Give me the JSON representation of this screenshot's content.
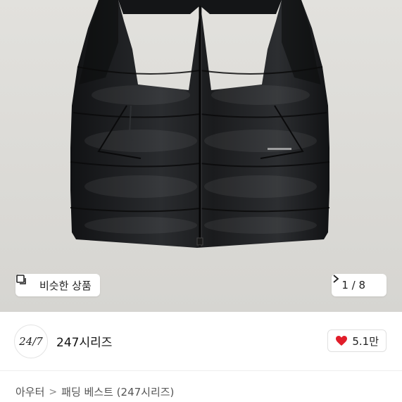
{
  "hero": {
    "image": "black-padded-vest-photo",
    "colors": {
      "background": "#dddcd8",
      "garment": "#1c1d1f"
    }
  },
  "similar": {
    "label": "비슷한 상품",
    "icon": "copy-icon"
  },
  "pager": {
    "text": "1 / 8",
    "icon": "chevron-right-icon"
  },
  "shop": {
    "logo_text": "24/7",
    "name": "247시리즈"
  },
  "like": {
    "count": "5.1만",
    "icon": "heart-icon",
    "color": "#e11d2a"
  },
  "breadcrumb": {
    "category": "아우터",
    "separator": ">",
    "subcategory": "패딩 베스트 (247시리즈)"
  }
}
